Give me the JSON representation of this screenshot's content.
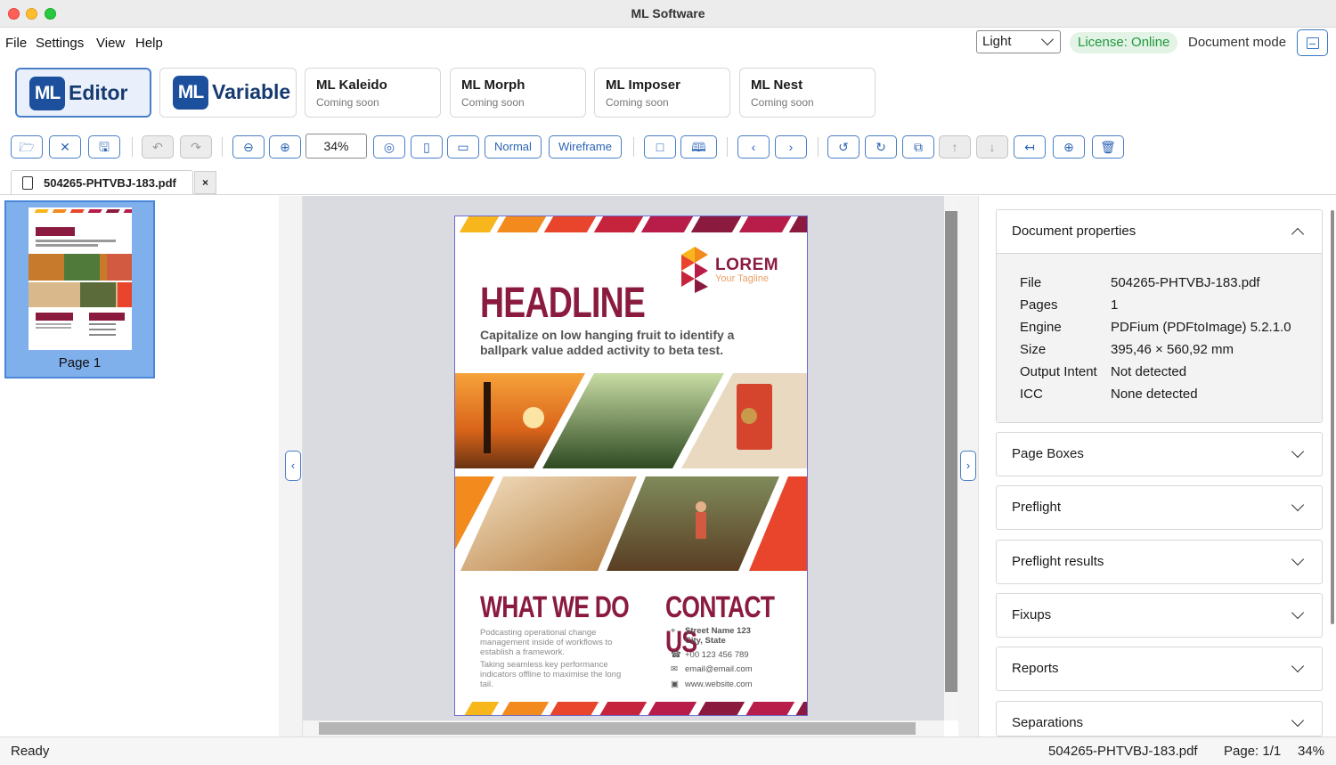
{
  "window": {
    "title": "ML Software"
  },
  "menu": [
    "File",
    "Settings",
    "View",
    "Help"
  ],
  "header": {
    "theme_value": "Light",
    "license": "License: Online",
    "document_mode_label": "Document mode"
  },
  "products": [
    {
      "logo": "ML",
      "name": "Editor",
      "active": true
    },
    {
      "logo": "ML",
      "name": "Variable",
      "active": false
    },
    {
      "name": "ML Kaleido",
      "sub": "Coming soon"
    },
    {
      "name": "ML Morph",
      "sub": "Coming soon"
    },
    {
      "name": "ML Imposer",
      "sub": "Coming soon"
    },
    {
      "name": "ML Nest",
      "sub": "Coming soon"
    }
  ],
  "toolbar": {
    "zoom": "34%",
    "normal_label": "Normal",
    "wireframe_label": "Wireframe",
    "icons": [
      "open-folder-icon",
      "close-file-icon",
      "save-icon",
      "undo-icon",
      "redo-icon",
      "zoom-out-icon",
      "zoom-in-icon",
      "zoom-fit-icon",
      "fit-page-icon",
      "fit-width-icon",
      "single-page-icon",
      "two-page-icon",
      "previous-page-icon",
      "next-page-icon",
      "rotate-left-icon",
      "rotate-right-icon",
      "duplicate-page-icon",
      "move-up-icon",
      "move-down-icon",
      "extract-page-icon",
      "insert-page-icon",
      "delete-icon"
    ]
  },
  "document_tab": {
    "name": "504265-PHTVBJ-183.pdf",
    "close": "×"
  },
  "thumbnails": [
    {
      "label": "Page 1"
    }
  ],
  "page_content": {
    "headline": "HEADLINE",
    "subheadline": "Capitalize on low hanging fruit to identify a ballpark value added activity to beta test.",
    "logo_text": "LOREM",
    "logo_tagline": "Your Tagline",
    "what_we_do_title": "WHAT WE DO",
    "what_we_do_p1": "Podcasting operational change management inside of workflows to establish a framework.",
    "what_we_do_p2": "Taking seamless key performance indicators offline to maximise the long tail.",
    "contact_title": "CONTACT US",
    "address_line1": "Street Name 123",
    "address_line2": "City, State",
    "phone": "+00 123 456 789",
    "email": "email@email.com",
    "website": "www.website.com"
  },
  "properties": {
    "title": "Document properties",
    "rows": [
      {
        "key": "File",
        "value": "504265-PHTVBJ-183.pdf"
      },
      {
        "key": "Pages",
        "value": "1"
      },
      {
        "key": "Engine",
        "value": "PDFium (PDFtoImage) 5.2.1.0"
      },
      {
        "key": "Size",
        "value": "395,46 × 560,92 mm"
      },
      {
        "key": "Output Intent",
        "value": "Not detected"
      },
      {
        "key": "ICC",
        "value": "None detected"
      }
    ]
  },
  "sections": [
    "Page Boxes",
    "Preflight",
    "Preflight results",
    "Fixups",
    "Reports",
    "Separations"
  ],
  "status": {
    "left": "Ready",
    "file": "504265-PHTVBJ-183.pdf",
    "page": "Page: 1/1",
    "zoom": "34%"
  },
  "colors": {
    "accent": "#4a7fc8",
    "license_green": "#1f9a3c",
    "headline_maroon": "#8a1b3f",
    "stripe_colors": [
      "#f7b61c",
      "#f28a1e",
      "#e8452c",
      "#b81c48",
      "#8a1b3f"
    ]
  }
}
